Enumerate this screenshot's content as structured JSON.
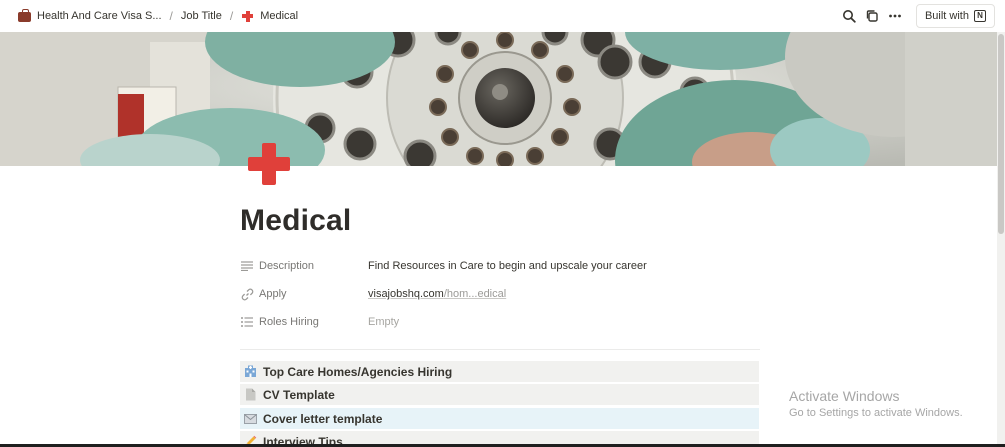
{
  "breadcrumb": {
    "items": [
      {
        "label": "Health And Care Visa S...",
        "icon": "briefcase-icon"
      },
      {
        "label": "Job Title",
        "icon": ""
      },
      {
        "label": "Medical",
        "icon": "red-cross-icon"
      }
    ],
    "separator": "/"
  },
  "toolbar": {
    "built_with_label": "Built with",
    "icons": [
      "search-icon",
      "duplicate-icon",
      "more-icon",
      "notion-logo-icon"
    ]
  },
  "page": {
    "icon": "red-cross-icon",
    "title": "Medical"
  },
  "properties": [
    {
      "name": "Description",
      "icon": "text-lines-icon",
      "value": "Find Resources in Care to begin and upscale your career"
    },
    {
      "name": "Apply",
      "icon": "link-icon",
      "value_domain": "visajobshq.com",
      "value_path": "/hom...edical"
    },
    {
      "name": "Roles Hiring",
      "icon": "list-icon",
      "value": "Empty"
    }
  ],
  "toggles": [
    {
      "label": "Top Care Homes/Agencies Hiring",
      "icon": "hospital-icon"
    },
    {
      "label": "CV Template",
      "icon": "page-icon"
    },
    {
      "label": "Cover letter template",
      "icon": "envelope-icon"
    },
    {
      "label": "Interview Tips",
      "icon": "pencil-icon"
    }
  ],
  "watermark": {
    "title": "Activate Windows",
    "subtitle": "Go to Settings to activate Windows."
  },
  "colors": {
    "accent_red": "#e0403a",
    "text": "#37352f",
    "muted": "#787774",
    "row_bg": "#f1f1ef",
    "row_blue": "#e7f3f8"
  }
}
